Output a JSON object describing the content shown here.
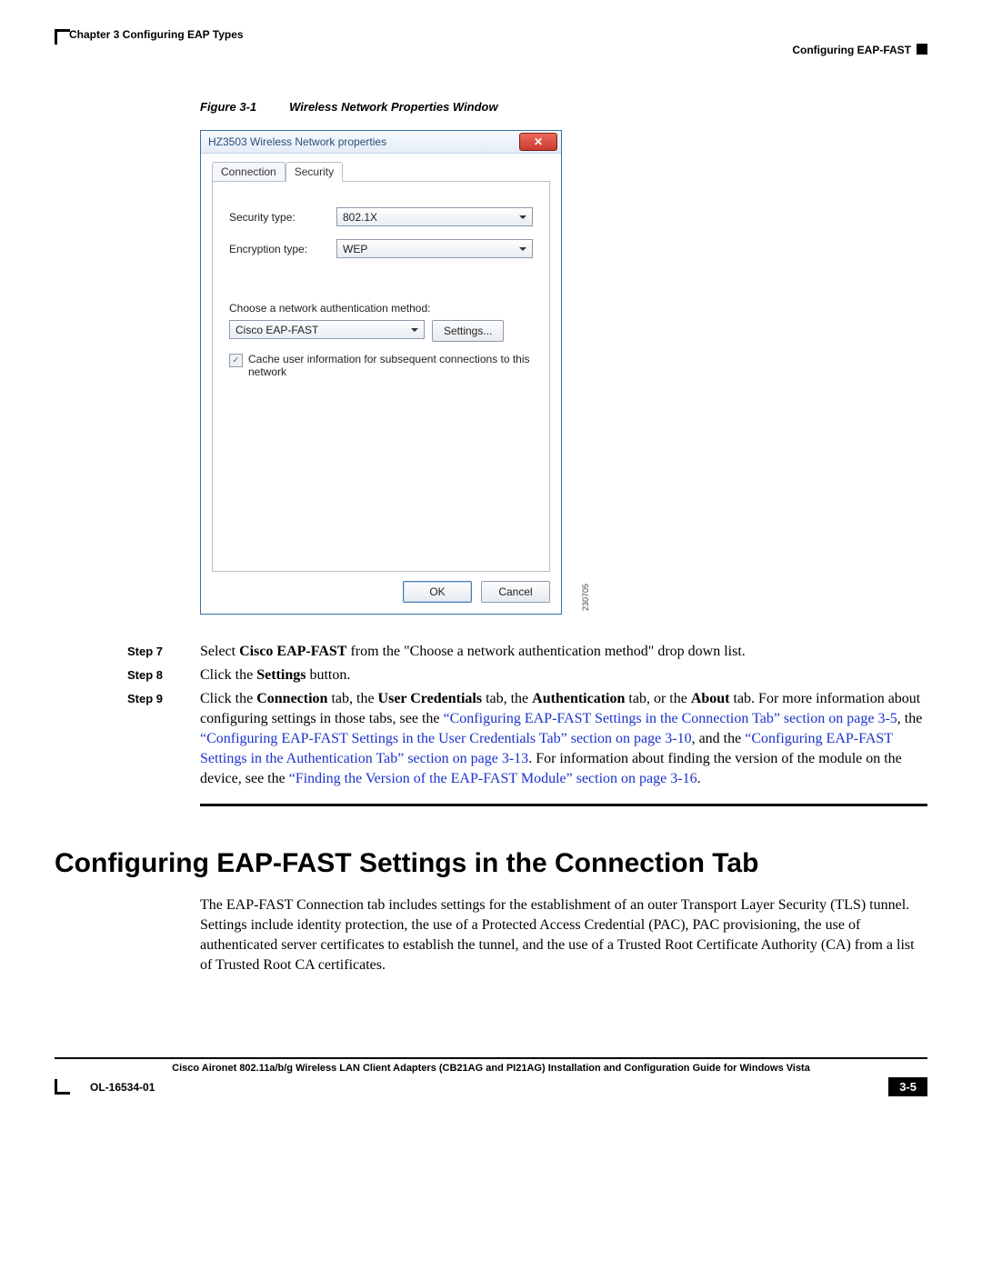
{
  "header": {
    "chapter": "Chapter 3      Configuring EAP Types",
    "section": "Configuring EAP-FAST"
  },
  "figure": {
    "label": "Figure 3-1",
    "title": "Wireless Network Properties Window",
    "id": "230705"
  },
  "dialog": {
    "title": "HZ3503 Wireless Network properties",
    "tab_connection": "Connection",
    "tab_security": "Security",
    "security_type_label": "Security type:",
    "security_type_value": "802.1X",
    "encryption_type_label": "Encryption type:",
    "encryption_type_value": "WEP",
    "auth_method_label": "Choose a network authentication method:",
    "auth_method_value": "Cisco EAP-FAST",
    "settings_button": "Settings...",
    "cache_checkbox": "Cache user information for subsequent connections to this network",
    "ok": "OK",
    "cancel": "Cancel"
  },
  "steps": {
    "s7_label": "Step 7",
    "s7_pre": "Select ",
    "s7_bold": "Cisco EAP-FAST",
    "s7_post": " from the \"Choose a network authentication method\" drop down list.",
    "s8_label": "Step 8",
    "s8_pre": "Click the ",
    "s8_bold": "Settings",
    "s8_post": " button.",
    "s9_label": "Step 9",
    "s9_p1": "Click the ",
    "s9_b1": "Connection",
    "s9_p2": " tab, the ",
    "s9_b2": "User Credentials",
    "s9_p3": " tab, the ",
    "s9_b3": "Authentication",
    "s9_p4": " tab, or the ",
    "s9_b4": "About",
    "s9_p5": " tab. For more information about configuring settings in those tabs, see the ",
    "s9_l1": "“Configuring EAP-FAST Settings in the Connection Tab” section on page 3-5",
    "s9_p6": ", the ",
    "s9_l2": "“Configuring EAP-FAST Settings in the User Credentials Tab” section on page 3-10",
    "s9_p7": ", and the ",
    "s9_l3": "“Configuring EAP-FAST Settings in the Authentication Tab” section on page 3-13",
    "s9_p8": ". For information about finding the version of the module on the device, see the ",
    "s9_l4": "“Finding the Version of the EAP-FAST Module” section on page 3-16",
    "s9_p9": "."
  },
  "section_heading": "Configuring EAP-FAST Settings in the Connection Tab",
  "section_para": "The EAP-FAST Connection tab includes settings for the establishment of an outer Transport Layer Security (TLS) tunnel. Settings include identity protection, the use of a Protected Access Credential (PAC), PAC provisioning, the use of authenticated server certificates to establish the tunnel, and the use of a Trusted Root Certificate Authority (CA) from a list of Trusted Root CA certificates.",
  "footer": {
    "book": "Cisco Aironet 802.11a/b/g Wireless LAN Client Adapters (CB21AG and PI21AG) Installation and Configuration Guide for Windows Vista",
    "doc": "OL-16534-01",
    "page": "3-5"
  }
}
